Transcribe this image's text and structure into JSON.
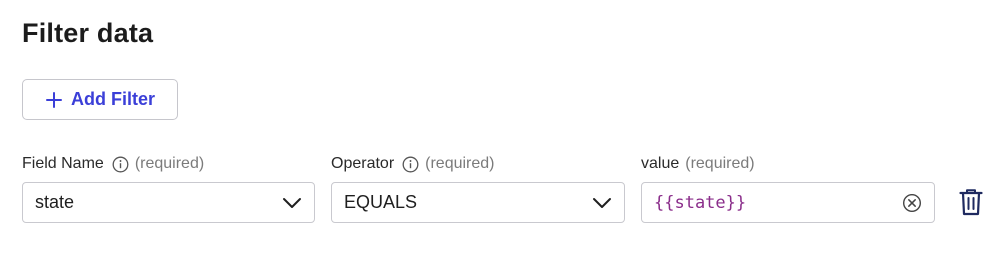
{
  "title": "Filter data",
  "add_filter_button": {
    "label": "Add Filter",
    "icon": "plus-icon"
  },
  "filter": {
    "field_name": {
      "label": "Field Name",
      "required_text": "(required)",
      "value": "state",
      "info_icon": "info-icon",
      "dropdown_icon": "chevron-down-icon"
    },
    "operator": {
      "label": "Operator",
      "required_text": "(required)",
      "value": "EQUALS",
      "info_icon": "info-icon",
      "dropdown_icon": "chevron-down-icon"
    },
    "value": {
      "label": "value",
      "required_text": "(required)",
      "value": "{{state}}",
      "clear_icon": "clear-circle-icon"
    },
    "delete_icon": "trash-icon"
  },
  "colors": {
    "accent": "#3b3fd8",
    "code_text": "#8a2d8a",
    "border": "#c9c9cf",
    "muted_text": "#7b7b7b",
    "trash": "#1f2a60"
  }
}
